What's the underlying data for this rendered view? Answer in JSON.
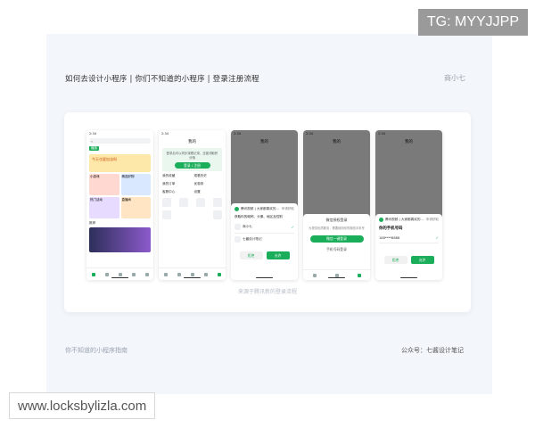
{
  "overlay": {
    "tg": "TG: MYYJJPP",
    "watermark": "www.locksbylizla.com"
  },
  "header": {
    "title": "如何去设计小程序 | 你们不知道的小程序 | 登录注册流程",
    "signature": "商小七"
  },
  "caption": "来源于腾讯新的登录流程",
  "footer": {
    "left": "你不知道的小程序指南",
    "right": "公众号：七酱设计笔记"
  },
  "colors": {
    "accent": "#1aad5a",
    "board": "#f3f6fb"
  },
  "phones": [
    {
      "time": "2:34",
      "tab_active": "播放",
      "banner": "今天也要加油呀",
      "section": "推荐",
      "cards": [
        "小游戏",
        "精选好物",
        "热门活动",
        "直播间"
      ]
    },
    {
      "time": "2:34",
      "title": "我的",
      "login_hint": "登录后可以同步观看记录，还能领取积分哦",
      "login_button": "登录 / 注册",
      "items": [
        "我的收藏",
        "观看历史",
        "我的订单",
        "优惠券",
        "客服中心",
        "设置"
      ]
    },
    {
      "time": "2:34",
      "title": "我的",
      "sheet_title": "腾讯视频 | 大家都喜欢的…",
      "sheet_sub": "申请获取",
      "sheet_desc": "获取你的昵称、头像、地区及性别",
      "profile_name": "商小七",
      "alt_account": "七酱设计笔记",
      "cancel": "拒绝",
      "allow": "允许"
    },
    {
      "time": "2:34",
      "title": "我的",
      "sheet_title": "微信授权登录",
      "sheet_desc": "为提供优质服务，需要使用你的微信手机号",
      "primary": "微信一键登录",
      "secondary": "手机号码登录"
    },
    {
      "time": "2:34",
      "title": "我的",
      "sheet_title": "腾讯视频 | 大家都喜欢的…",
      "sheet_sub": "申请获取",
      "phone_label": "你的手机号码",
      "phone_number": "188****8888",
      "cancel": "拒绝",
      "allow": "允许"
    }
  ]
}
